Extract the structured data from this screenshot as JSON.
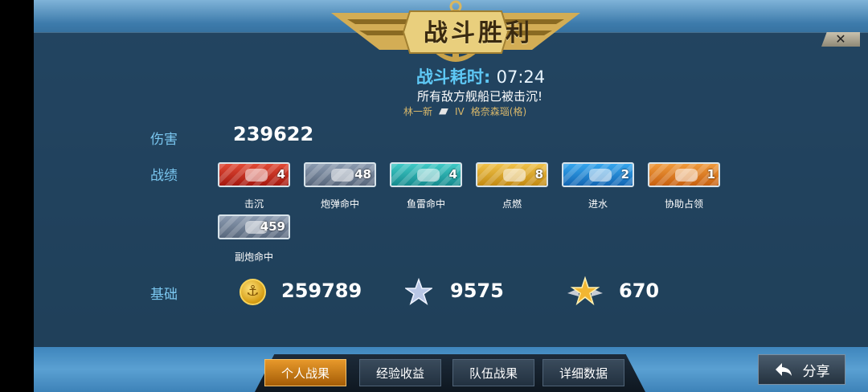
{
  "banner": {
    "title": "战斗胜利"
  },
  "close": {
    "symbol": "✕"
  },
  "summary": {
    "time_label": "战斗耗时:",
    "time_value": "07:24",
    "message": "所有敌方舰船已被击沉!",
    "player_name": "林一新",
    "ship_tier": "IV",
    "ship_name": "格奈森瑙(格)"
  },
  "damage": {
    "label": "伤害",
    "value": "239622"
  },
  "achievements": {
    "label": "战绩",
    "items": [
      {
        "name": "击沉",
        "count": "4",
        "icon": "sink-icon",
        "color": "#c8281b"
      },
      {
        "name": "炮弹命中",
        "count": "48",
        "icon": "shell-hit-icon",
        "color": "#6d7c90"
      },
      {
        "name": "鱼雷命中",
        "count": "4",
        "icon": "torpedo-icon",
        "color": "#23a9a8"
      },
      {
        "name": "点燃",
        "count": "8",
        "icon": "fire-icon",
        "color": "#dba72c"
      },
      {
        "name": "进水",
        "count": "2",
        "icon": "flood-icon",
        "color": "#2386d1"
      },
      {
        "name": "协助占领",
        "count": "1",
        "icon": "capture-icon",
        "color": "#dd7a1e"
      },
      {
        "name": "副炮命中",
        "count": "459",
        "icon": "secondary-gun-icon",
        "color": "#6d7c90"
      }
    ]
  },
  "base": {
    "label": "基础",
    "credits": "259789",
    "xp": "9575",
    "commander_xp": "670"
  },
  "tabs": [
    {
      "label": "个人战果",
      "active": true
    },
    {
      "label": "经验收益",
      "active": false
    },
    {
      "label": "队伍战果",
      "active": false
    },
    {
      "label": "详细数据",
      "active": false
    }
  ],
  "share": {
    "label": "分享"
  }
}
